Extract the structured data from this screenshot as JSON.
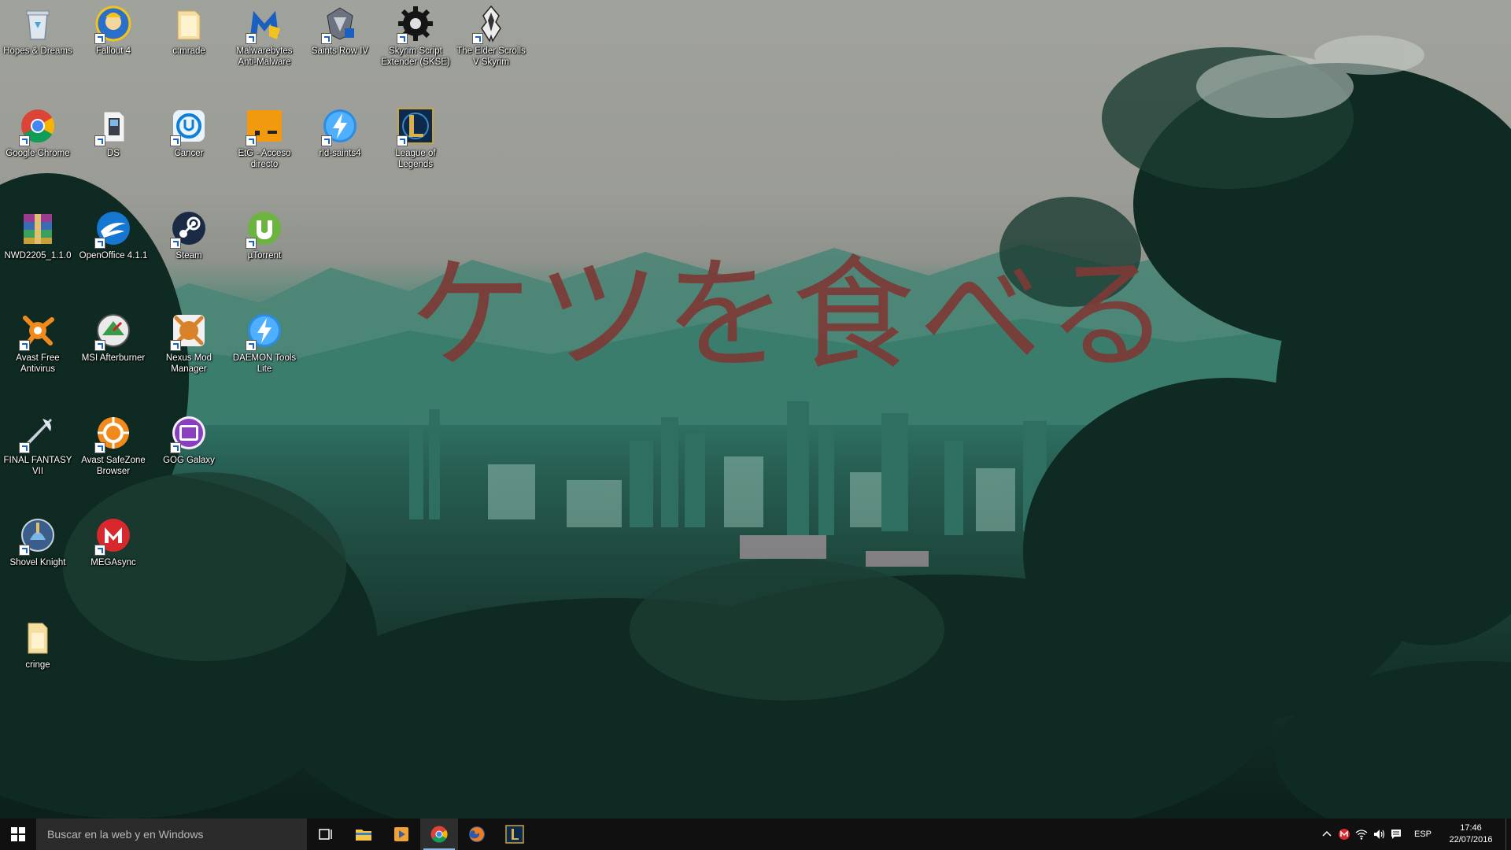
{
  "wallpaper": {
    "overlay_text": "ケツを食べる"
  },
  "desktop_icons": [
    {
      "label": "Hopes & Dreams",
      "icon": "recycle-bin-icon"
    },
    {
      "label": "Fallout 4",
      "icon": "fallout-vault-boy-icon"
    },
    {
      "label": "c:mrade",
      "icon": "folder-icon"
    },
    {
      "label": "Malwarebytes Anti-Malware",
      "icon": "malwarebytes-icon"
    },
    {
      "label": "Saints Row IV",
      "icon": "saints-row-icon"
    },
    {
      "label": "Skyrim Script Extender (SKSE)",
      "icon": "skse-gear-icon"
    },
    {
      "label": "The Elder Scrolls V Skyrim",
      "icon": "skyrim-dragon-icon"
    },
    {
      "label": "Google Chrome",
      "icon": "chrome-icon"
    },
    {
      "label": "DS",
      "icon": "ds-file-icon"
    },
    {
      "label": "Cancer",
      "icon": "uplay-icon"
    },
    {
      "label": "EtG - Acceso directo",
      "icon": "etg-icon"
    },
    {
      "label": "rld-saints4",
      "icon": "daemon-lightning-icon"
    },
    {
      "label": "League of Legends",
      "icon": "league-of-legends-icon"
    },
    {
      "label": "NWD2205_1.1.0",
      "icon": "winrar-archive-icon"
    },
    {
      "label": "OpenOffice 4.1.1",
      "icon": "openoffice-icon"
    },
    {
      "label": "Steam",
      "icon": "steam-icon"
    },
    {
      "label": "µTorrent",
      "icon": "utorrent-icon"
    },
    {
      "label": "Avast Free Antivirus",
      "icon": "avast-icon"
    },
    {
      "label": "MSI Afterburner",
      "icon": "msi-afterburner-icon"
    },
    {
      "label": "Nexus Mod Manager",
      "icon": "nexus-mod-manager-icon"
    },
    {
      "label": "DAEMON Tools Lite",
      "icon": "daemon-tools-icon"
    },
    {
      "label": "FINAL FANTASY VII",
      "icon": "final-fantasy-icon"
    },
    {
      "label": "Avast SafeZone Browser",
      "icon": "avast-safezone-icon"
    },
    {
      "label": "GOG Galaxy",
      "icon": "gog-galaxy-icon"
    },
    {
      "label": "Shovel Knight",
      "icon": "shovel-knight-icon"
    },
    {
      "label": "MEGAsync",
      "icon": "megasync-icon"
    },
    {
      "label": "cringe",
      "icon": "file-icon"
    }
  ],
  "taskbar": {
    "search_placeholder": "Buscar en la web y en Windows",
    "pinned": [
      {
        "name": "task-view-icon",
        "active": false
      },
      {
        "name": "file-explorer-icon",
        "active": false
      },
      {
        "name": "media-player-icon",
        "active": false
      },
      {
        "name": "chrome-taskbar-icon",
        "active": true
      },
      {
        "name": "firefox-icon",
        "active": false
      },
      {
        "name": "league-taskbar-icon",
        "active": false
      }
    ],
    "tray": {
      "language": "ESP",
      "time": "17:46",
      "date": "22/07/2016"
    }
  },
  "colors": {
    "overlay_text": "#7d3a36",
    "taskbar_bg": "#101010",
    "search_bg": "#2b2b2b",
    "accent": "#86b8e6"
  }
}
